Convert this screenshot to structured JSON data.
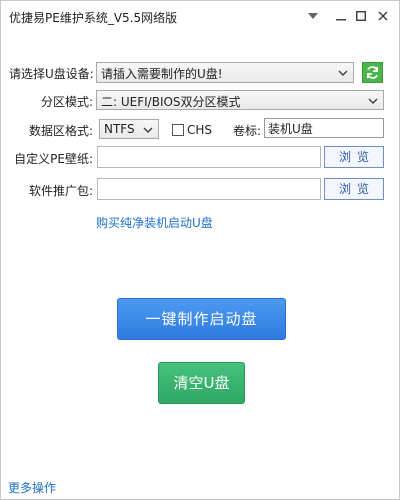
{
  "window": {
    "title": "优捷易PE维护系统_V5.5网络版"
  },
  "usb_device": {
    "label": "请选择U盘设备:",
    "selected": "请插入需要制作的U盘!"
  },
  "partition_mode": {
    "label": "分区模式:",
    "selected": "二: UEFI/BIOS双分区模式"
  },
  "data_format": {
    "label": "数据区格式:",
    "selected": "NTFS",
    "chs_label": "CHS",
    "chs_checked": false
  },
  "volume_label": {
    "label": "卷标:",
    "value": "装机U盘"
  },
  "wallpaper": {
    "label": "自定义PE壁纸:",
    "value": "",
    "browse_label": "浏览"
  },
  "software": {
    "label": "软件推广包:",
    "value": "",
    "browse_label": "浏览"
  },
  "buy_link": "购买纯净装机启动U盘",
  "actions": {
    "make_boot": "一键制作启动盘",
    "clear_usb": "清空U盘"
  },
  "more_ops": "更多操作",
  "colors": {
    "primary": "#2e7be0",
    "success": "#2ea862",
    "link": "#1e6fc8",
    "refresh": "#4bb44b"
  }
}
